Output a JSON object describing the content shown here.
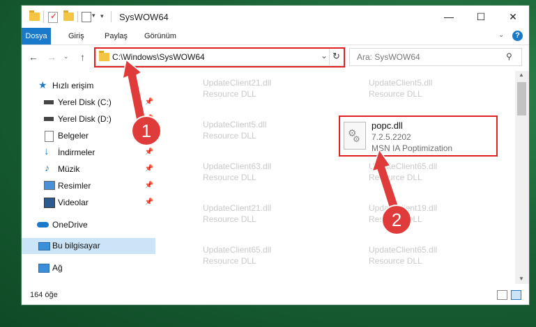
{
  "window": {
    "title": "SysWOW64",
    "controls": {
      "minimize": "—",
      "maximize": "☐",
      "close": "✕"
    }
  },
  "ribbon": {
    "tabs": [
      {
        "label": "Dosya",
        "active": true
      },
      {
        "label": "Giriş"
      },
      {
        "label": "Paylaş"
      },
      {
        "label": "Görünüm"
      }
    ],
    "help_label": "?"
  },
  "address_bar": {
    "path": "C:\\Windows\\SysWOW64",
    "search_placeholder": "Ara: SysWOW64"
  },
  "nav_pane": {
    "items": [
      {
        "label": "Hızlı erişim",
        "icon": "star-icon"
      },
      {
        "label": "Yerel Disk (C:)",
        "icon": "drive-icon",
        "pinned": true
      },
      {
        "label": "Yerel Disk (D:)",
        "icon": "drive-icon",
        "pinned": true
      },
      {
        "label": "Belgeler",
        "icon": "document-icon",
        "pinned": true
      },
      {
        "label": "İndirmeler",
        "icon": "download-icon",
        "pinned": true
      },
      {
        "label": "Müzik",
        "icon": "music-icon",
        "pinned": true
      },
      {
        "label": "Resimler",
        "icon": "pictures-icon",
        "pinned": true
      },
      {
        "label": "Videolar",
        "icon": "video-icon",
        "pinned": true
      },
      {
        "label": "OneDrive",
        "icon": "cloud-icon"
      },
      {
        "label": "Bu bilgisayar",
        "icon": "computer-icon",
        "selected": true
      },
      {
        "label": "Ağ",
        "icon": "network-icon"
      }
    ]
  },
  "files": {
    "ghost_items": [
      {
        "name": "UpdateClient21.dll",
        "desc": "Resource DLL"
      },
      {
        "name": "UpdateClient5.dll",
        "desc": "Resource DLL"
      },
      {
        "name": "UpdateClient5.dll",
        "desc": "Resource DLL"
      },
      {
        "name": "UpdateClient63.dll",
        "desc": "Resource DLL"
      },
      {
        "name": "UpdateClient65.dll",
        "desc": "Resource DLL"
      },
      {
        "name": "UpdateClient21.dll",
        "desc": "Resource DLL"
      },
      {
        "name": "UpdateClient19.dll",
        "desc": "Resource DLL"
      },
      {
        "name": "UpdateClient65.dll",
        "desc": "Resource DLL"
      },
      {
        "name": "UpdateClient65.dll",
        "desc": "Resource DLL"
      }
    ],
    "highlighted": {
      "name": "popc.dll",
      "version": "7.2.5.2202",
      "description": "MSN IA Poptimization"
    }
  },
  "status_bar": {
    "item_count": "164 öğe"
  },
  "annotations": {
    "step1": "1",
    "step2": "2",
    "color": "#e02020"
  }
}
